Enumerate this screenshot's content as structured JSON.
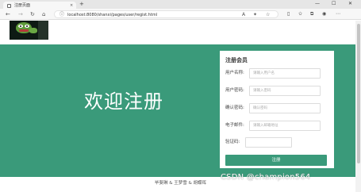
{
  "browser": {
    "tab_title": "注册页面",
    "tab_close": "×",
    "new_tab": "+",
    "url": "localhost:8080/shanxi/pages/user/regist.html",
    "minimize": "—",
    "maximize": "☐",
    "close": "✕"
  },
  "hero": {
    "title": "欢迎注册"
  },
  "form": {
    "title": "注册会员",
    "username_label": "用户名称:",
    "username_placeholder": "请输入用户名",
    "password_label": "用户密码:",
    "password_placeholder": "请输入密码",
    "confirm_label": "确认密码:",
    "confirm_placeholder": "确认密码",
    "email_label": "电子邮件:",
    "email_placeholder": "请输入邮箱地址",
    "captcha_label": "验证码:",
    "captcha_value": "",
    "submit_label": "注册"
  },
  "footer": {
    "text": "毕斐琳 & 王梦雪 & 胡蝶晖"
  },
  "watermark": {
    "text": "CSDN @champion564"
  },
  "colors": {
    "accent": "#3a9a7a"
  }
}
